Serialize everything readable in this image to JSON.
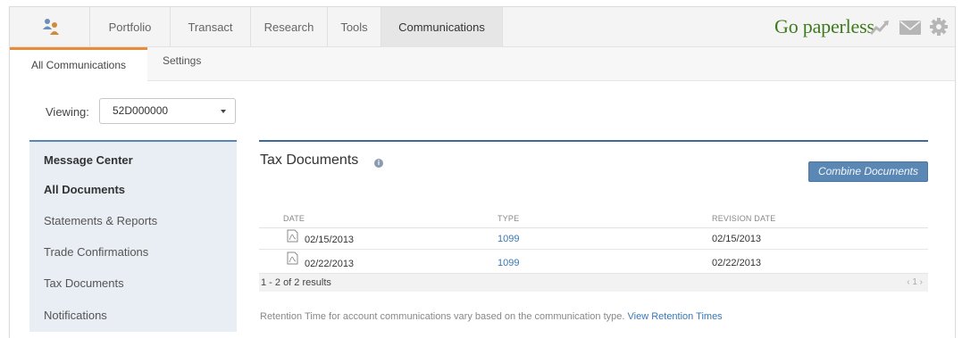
{
  "nav": {
    "tabs": [
      {
        "label": "Portfolio"
      },
      {
        "label": "Transact"
      },
      {
        "label": "Research"
      },
      {
        "label": "Tools"
      },
      {
        "label": "Communications",
        "active": true
      }
    ],
    "go_paperless": "Go paperless",
    "icons": [
      "team-icon",
      "chart-trend-icon",
      "mail-icon",
      "gear-icon"
    ]
  },
  "subnav": {
    "tabs": [
      {
        "label": "All Communications",
        "active": true
      },
      {
        "label": "Settings"
      }
    ]
  },
  "viewing": {
    "label": "Viewing:",
    "selected": "52D000000"
  },
  "sidebar": {
    "items": [
      {
        "label": "Message Center",
        "bold": true
      },
      {
        "label": "All Documents",
        "bold": true
      },
      {
        "label": "Statements & Reports"
      },
      {
        "label": "Trade Confirmations"
      },
      {
        "label": "Tax Documents"
      },
      {
        "label": "Notifications"
      }
    ]
  },
  "main": {
    "title": "Tax Documents",
    "info_glyph": "i",
    "combine_label": "Combine Documents",
    "columns": [
      "DATE",
      "TYPE",
      "REVISION DATE"
    ],
    "rows": [
      {
        "date": "02/15/2013",
        "type": "1099",
        "revision": "02/15/2013"
      },
      {
        "date": "02/22/2013",
        "type": "1099",
        "revision": "02/22/2013"
      }
    ],
    "results": "1 - 2 of 2 results",
    "pager": "‹ 1 ›",
    "retention_text": "Retention Time for account communications vary based on the communication type.",
    "retention_link": "View Retention Times"
  },
  "colors": {
    "accent_orange": "#e88b3a",
    "brand_green": "#3c7a1c",
    "link_blue": "#3a78b5",
    "button_blue": "#5b87b5"
  }
}
